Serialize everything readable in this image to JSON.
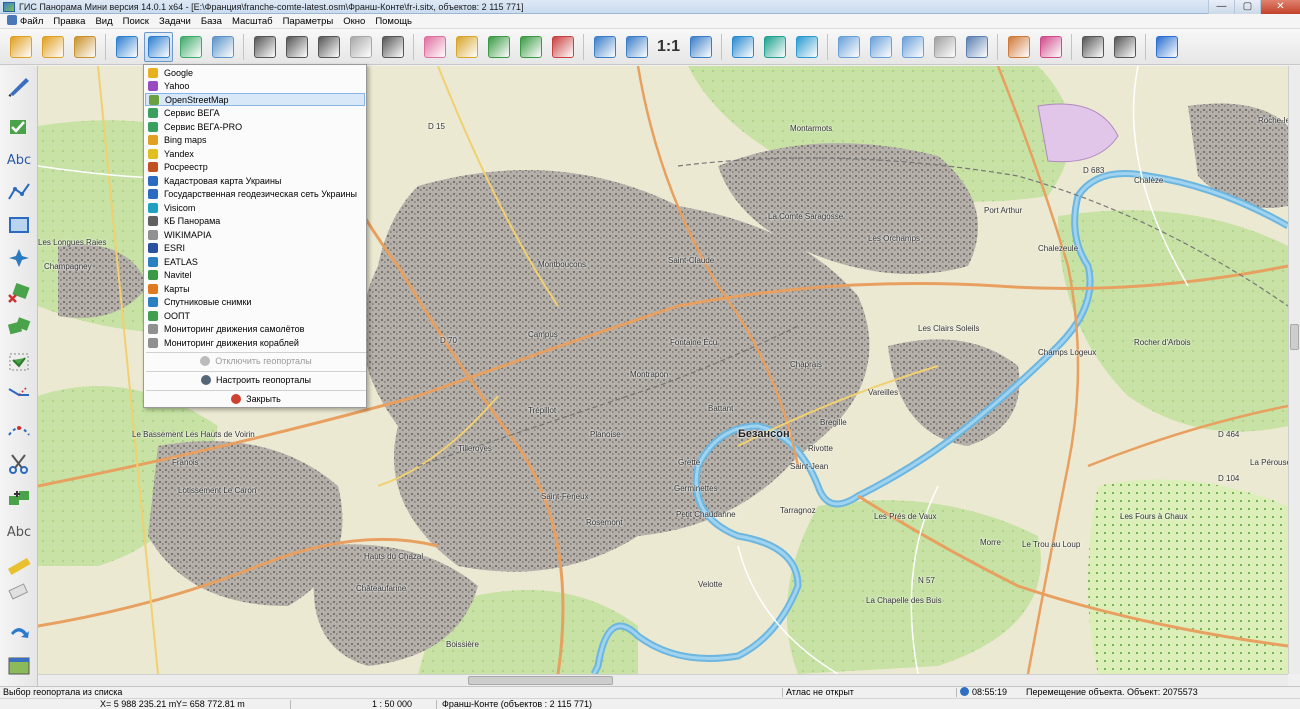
{
  "window": {
    "title": "ГИС Панорама Мини версия 14.0.1 x64 - [E:\\Франция\\franche-comte-latest.osm\\Франш-Конте\\fr-i.sitx, объектов: 2 115 771]",
    "minimize": "—",
    "maximize": "▢",
    "close": "✕"
  },
  "menu": [
    "Файл",
    "Правка",
    "Вид",
    "Поиск",
    "Задачи",
    "База",
    "Масштаб",
    "Параметры",
    "Окно",
    "Помощь"
  ],
  "toolbar": {
    "scale_1_1": "1:1",
    "buttons": [
      {
        "name": "open-map-icon",
        "color": "#e0a020"
      },
      {
        "name": "add-data-icon",
        "color": "#e0a020"
      },
      {
        "name": "dbm-icon",
        "color": "#c9922a"
      },
      {
        "name": "globe-icon",
        "color": "#2f7fd0"
      },
      {
        "name": "geoportal-icon",
        "color": "#2f7fd0"
      },
      {
        "name": "layers-icon",
        "color": "#3ea96a"
      },
      {
        "name": "legend-icon",
        "color": "#5b93c9"
      },
      {
        "name": "binoculars-icon",
        "color": "#555555"
      },
      {
        "name": "binoculars-text-icon",
        "color": "#555555"
      },
      {
        "name": "binoculars-area-icon",
        "color": "#555555"
      },
      {
        "name": "binoculars-disabled-icon",
        "color": "#a8a8a8"
      },
      {
        "name": "list-icon",
        "color": "#555555"
      },
      {
        "name": "select-object-icon",
        "color": "#e06fa0"
      },
      {
        "name": "flashlight-icon",
        "color": "#d7a52a"
      },
      {
        "name": "add-object-icon",
        "color": "#3a9a44"
      },
      {
        "name": "edit-object-icon",
        "color": "#3a9a44"
      },
      {
        "name": "delete-object-icon",
        "color": "#c94040"
      },
      {
        "name": "zoom-out-icon",
        "color": "#3a7ec8"
      },
      {
        "name": "zoom-in-icon",
        "color": "#3a7ec8"
      },
      {
        "name": "fit-window-icon",
        "color": "#3a7ec8"
      },
      {
        "name": "display-window-icon",
        "color": "#2a8ad0"
      },
      {
        "name": "accept-icon",
        "color": "#1fa090"
      },
      {
        "name": "back-arrow-icon",
        "color": "#2a9ad0"
      },
      {
        "name": "cursor-icon",
        "color": "#6aa0d8"
      },
      {
        "name": "globe-cursor-icon",
        "color": "#6aa0d8"
      },
      {
        "name": "table-cursor-icon",
        "color": "#6aa0d8"
      },
      {
        "name": "dbm-cursor-icon",
        "color": "#a0a0a0"
      },
      {
        "name": "form-text-icon",
        "color": "#5b7fb0"
      },
      {
        "name": "palette-icon",
        "color": "#d07a3a"
      },
      {
        "name": "route-icon",
        "color": "#d04a8a"
      },
      {
        "name": "print-icon",
        "color": "#555555"
      },
      {
        "name": "print-preview-icon",
        "color": "#555555"
      },
      {
        "name": "help-icon",
        "color": "#2a6fd0"
      }
    ]
  },
  "lefttools": {
    "abc1": "Abc",
    "abc2": "Abc"
  },
  "dropdown": {
    "items": [
      {
        "label": "Google",
        "color": "#e8b020"
      },
      {
        "label": "Yahoo",
        "color": "#9a4ac0"
      },
      {
        "label": "OpenStreetMap",
        "color": "#6aa040",
        "selected": true
      },
      {
        "label": "Сервис ВЕГА",
        "color": "#3aa060"
      },
      {
        "label": "Сервис ВЕГА-PRO",
        "color": "#3aa060"
      },
      {
        "label": "Bing maps",
        "color": "#e0a020"
      },
      {
        "label": "Yandex",
        "color": "#e0c020"
      },
      {
        "label": "Росреестр",
        "color": "#c05020"
      },
      {
        "label": "Кадастровая карта Украины",
        "color": "#2a6ac0"
      },
      {
        "label": "Государственная геодезическая сеть Украины",
        "color": "#2a6ac0"
      },
      {
        "label": "Visicom",
        "color": "#20a0c0"
      },
      {
        "label": "КБ Панорама",
        "color": "#606060"
      },
      {
        "label": "WIKIMAPIA",
        "color": "#909090"
      },
      {
        "label": "ESRI",
        "color": "#2a50a0"
      },
      {
        "label": "EATLAS",
        "color": "#2a80c0"
      },
      {
        "label": "Navitel",
        "color": "#3a9a44"
      },
      {
        "label": "Карты",
        "color": "#e07a20"
      },
      {
        "label": "Спутниковые снимки",
        "color": "#2a80c0"
      },
      {
        "label": "ООПТ",
        "color": "#40a050"
      },
      {
        "label": "Мониторинг движения самолётов",
        "color": "#909090"
      },
      {
        "label": "Мониторинг движения кораблей",
        "color": "#909090"
      }
    ],
    "disable_label": "Отключить геопорталы",
    "configure_label": "Настроить геопорталы",
    "close_label": "Закрыть"
  },
  "map": {
    "labels": [
      {
        "text": "D 15",
        "cls": ""
      },
      {
        "text": "Les Longues Raies",
        "cls": ""
      },
      {
        "text": "Champagney",
        "cls": ""
      },
      {
        "text": "Montboucons",
        "cls": ""
      },
      {
        "text": "Montarmots",
        "cls": ""
      },
      {
        "text": "La Comte Saragosse",
        "cls": ""
      },
      {
        "text": "Port Arthur",
        "cls": ""
      },
      {
        "text": "Chalezeule",
        "cls": ""
      },
      {
        "text": "Chalèze",
        "cls": ""
      },
      {
        "text": "D 683",
        "cls": ""
      },
      {
        "text": "Les Orchamps",
        "cls": ""
      },
      {
        "text": "Saint-Claude",
        "cls": ""
      },
      {
        "text": "Campus",
        "cls": ""
      },
      {
        "text": "Fontaine Écu",
        "cls": ""
      },
      {
        "text": "Chaprais",
        "cls": ""
      },
      {
        "text": "Les Clairs Soleils",
        "cls": ""
      },
      {
        "text": "Vareilles",
        "cls": ""
      },
      {
        "text": "Montrapon",
        "cls": ""
      },
      {
        "text": "Battant",
        "cls": ""
      },
      {
        "text": "Безансон",
        "cls": "city"
      },
      {
        "text": "Bregille",
        "cls": ""
      },
      {
        "text": "Tilleroyes",
        "cls": ""
      },
      {
        "text": "Trépillot",
        "cls": ""
      },
      {
        "text": "Planoise",
        "cls": ""
      },
      {
        "text": "Rivotte",
        "cls": ""
      },
      {
        "text": "Saint-Jean",
        "cls": ""
      },
      {
        "text": "Grette",
        "cls": ""
      },
      {
        "text": "Saint-Ferjeux",
        "cls": ""
      },
      {
        "text": "Germinettes",
        "cls": ""
      },
      {
        "text": "Tarragnoz",
        "cls": ""
      },
      {
        "text": "Rosemont",
        "cls": ""
      },
      {
        "text": "Petit Chaudanne",
        "cls": ""
      },
      {
        "text": "Les Prés de Vaux",
        "cls": ""
      },
      {
        "text": "Morre",
        "cls": ""
      },
      {
        "text": "Le Trou au Loup",
        "cls": ""
      },
      {
        "text": "Les Fours à Chaux",
        "cls": ""
      },
      {
        "text": "Hauts du Chazal",
        "cls": ""
      },
      {
        "text": "Châteaufarine",
        "cls": ""
      },
      {
        "text": "Velotte",
        "cls": ""
      },
      {
        "text": "La Chapelle des Buis",
        "cls": ""
      },
      {
        "text": "Boissière",
        "cls": ""
      },
      {
        "text": "Le Bassement Les Hauts de Voirin",
        "cls": ""
      },
      {
        "text": "Franois",
        "cls": ""
      },
      {
        "text": "Lotissement Le Caron",
        "cls": ""
      },
      {
        "text": "D 464",
        "cls": ""
      },
      {
        "text": "N 57",
        "cls": ""
      },
      {
        "text": "D 70",
        "cls": ""
      },
      {
        "text": "Rocher d'Arbois",
        "cls": ""
      },
      {
        "text": "Champs Logeux",
        "cls": ""
      },
      {
        "text": "La Pérouse",
        "cls": ""
      },
      {
        "text": "D 104",
        "cls": ""
      },
      {
        "text": "Roche-lez-Beaupré",
        "cls": ""
      }
    ]
  },
  "status": {
    "hint": "Выбор геопортала из списка",
    "atlas": "Атлас не открыт",
    "time": "08:55:19",
    "message": "Перемещение объекта. Объект: 2075573",
    "x_coord": "X=  5 988 235.21 m",
    "y_coord": "Y=    658 772.81 m",
    "scale": "1 : 50 000",
    "map_name": "Франш-Конте   (объектов : 2 115 771)"
  }
}
